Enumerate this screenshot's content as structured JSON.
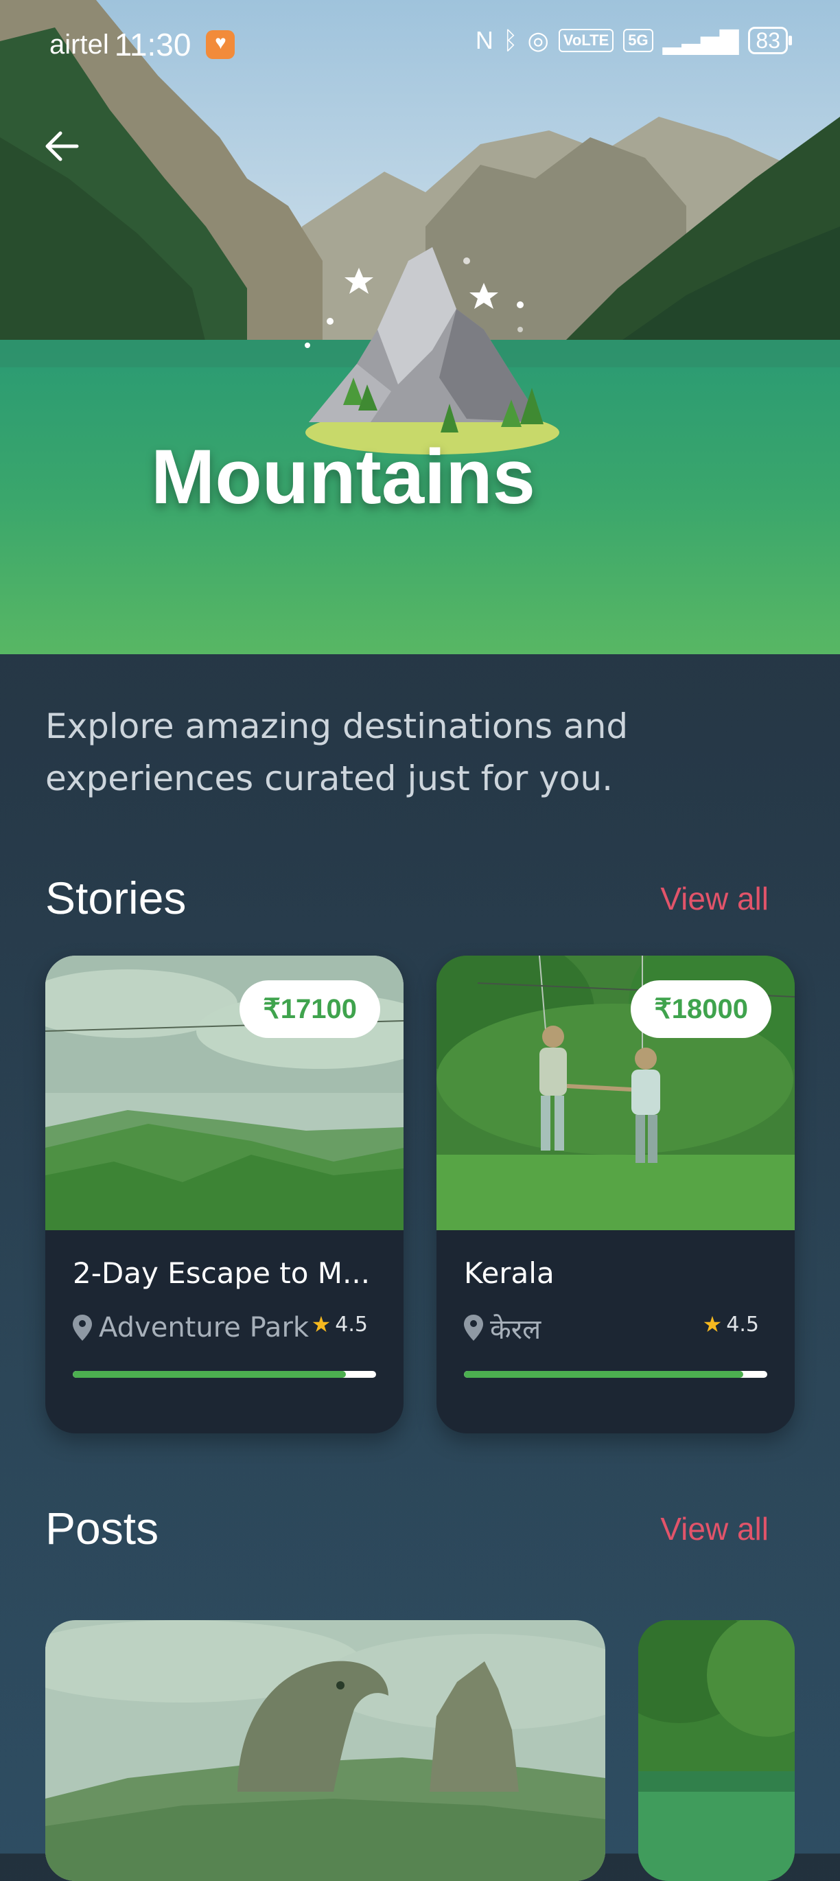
{
  "status_bar": {
    "carrier": "airtel",
    "time": "11:30",
    "network": "VoLTE",
    "network_gen": "5G",
    "battery": "83"
  },
  "hero": {
    "title": "Mountains",
    "icon": "mountain-illustration"
  },
  "intro": "Explore amazing destinations and experiences curated just for you.",
  "stories": {
    "title": "Stories",
    "view_all": "View all",
    "items": [
      {
        "price": "₹17100",
        "name": "2-Day Escape to M...",
        "location": "Adventure Park",
        "rating": "4.5",
        "progress": 0.9
      },
      {
        "price": "₹18000",
        "name": "Kerala",
        "location": "केरल",
        "rating": "4.5",
        "progress": 0.92
      }
    ]
  },
  "posts": {
    "title": "Posts",
    "view_all": "View all"
  },
  "colors": {
    "accent": "#e2546a",
    "price_green": "#3fa34d",
    "progress_green": "#4caf50",
    "star": "#f5b81f"
  }
}
